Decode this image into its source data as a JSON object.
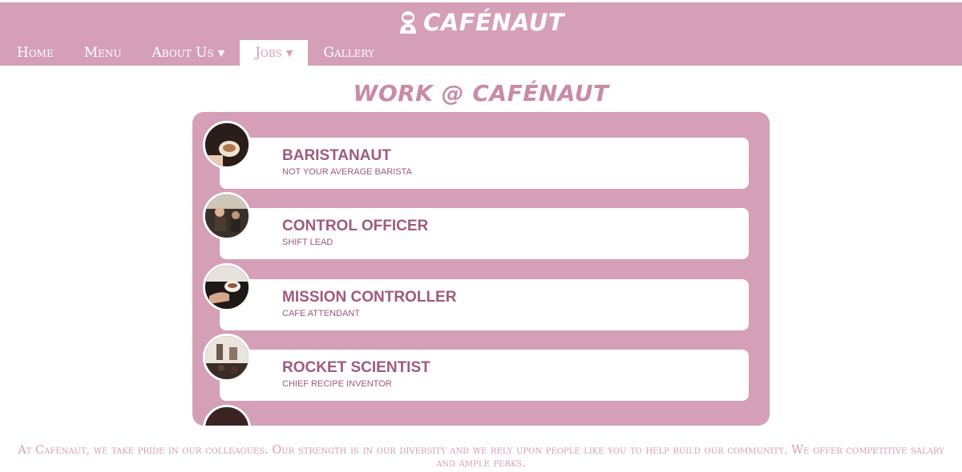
{
  "header": {
    "logo_text": "CAFÉNAUT",
    "logo_icon": "astronaut-icon"
  },
  "nav": {
    "items": [
      {
        "label": "Home"
      },
      {
        "label": "Menu"
      },
      {
        "label": "About Us"
      },
      {
        "label": "Jobs"
      },
      {
        "label": "Gallery"
      }
    ],
    "active": "Jobs"
  },
  "page": {
    "title": "WORK @ CAFÉNAUT"
  },
  "jobs": [
    {
      "title": "BARISTANAUT",
      "subtitle": "NOT YOUR AVERAGE BARISTA"
    },
    {
      "title": "CONTROL OFFICER",
      "subtitle": "SHIFT LEAD"
    },
    {
      "title": "MISSION CONTROLLER",
      "subtitle": "CAFE ATTENDANT"
    },
    {
      "title": "ROCKET SCIENTIST",
      "subtitle": "CHIEF RECIPE INVENTOR"
    }
  ],
  "footer": {
    "text": "At Cafénaut, we take pride in our colleagues. Our strength is in our diversity and we rely upon people like you to help build our community. We offer competitive salary and ample perks."
  },
  "colors": {
    "brand": "#d59fb8",
    "accent_text": "#a05a7e",
    "title": "#c98aa7"
  }
}
